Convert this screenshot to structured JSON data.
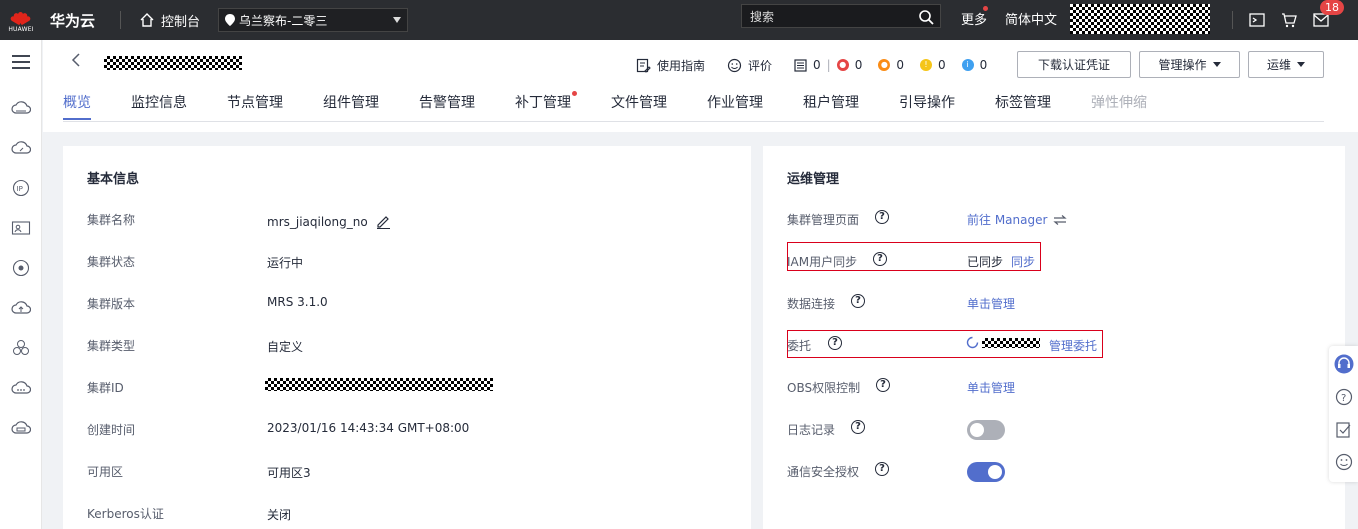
{
  "topbar": {
    "logo_text": "HUAWEI",
    "brand": "华为云",
    "console_label": "控制台",
    "region": "乌兰察布-二零三",
    "search_placeholder": "搜索",
    "more": "更多",
    "language": "简体中文",
    "notification_count": "18"
  },
  "header": {
    "tools": {
      "guide": "使用指南",
      "rate": "评价",
      "alarm_counts": [
        "0",
        "0",
        "0",
        "0",
        "0"
      ]
    },
    "buttons": {
      "download_cred": "下载认证凭证",
      "manage_ops": "管理操作",
      "maintenance": "运维"
    },
    "tabs": [
      {
        "label": "概览",
        "state": "active"
      },
      {
        "label": "监控信息"
      },
      {
        "label": "节点管理"
      },
      {
        "label": "组件管理"
      },
      {
        "label": "告警管理"
      },
      {
        "label": "补丁管理",
        "dot": true
      },
      {
        "label": "文件管理"
      },
      {
        "label": "作业管理"
      },
      {
        "label": "租户管理"
      },
      {
        "label": "引导操作"
      },
      {
        "label": "标签管理"
      },
      {
        "label": "弹性伸缩",
        "state": "disabled"
      }
    ]
  },
  "basic_info": {
    "title": "基本信息",
    "rows": [
      {
        "label": "集群名称",
        "value": "mrs_jiaqilong_no"
      },
      {
        "label": "集群状态",
        "value": "运行中"
      },
      {
        "label": "集群版本",
        "value": "MRS 3.1.0"
      },
      {
        "label": "集群类型",
        "value": "自定义"
      },
      {
        "label": "集群ID",
        "value": ""
      },
      {
        "label": "创建时间",
        "value": "2023/01/16 14:43:34 GMT+08:00"
      },
      {
        "label": "可用区",
        "value": "可用区3"
      },
      {
        "label": "Kerberos认证",
        "value": "关闭"
      }
    ]
  },
  "ops": {
    "title": "运维管理",
    "rows": [
      {
        "label": "集群管理页面",
        "link": "前往 Manager"
      },
      {
        "label": "IAM用户同步",
        "value": "已同步",
        "link": "同步"
      },
      {
        "label": "数据连接",
        "link": "单击管理"
      },
      {
        "label": "委托",
        "link": "管理委托"
      },
      {
        "label": "OBS权限控制",
        "link": "单击管理"
      },
      {
        "label": "日志记录",
        "toggle": false
      },
      {
        "label": "通信安全授权",
        "toggle": true
      }
    ]
  },
  "colors": {
    "accent": "#526ecc",
    "topbar": "#2b2d31",
    "highlight_border": "#d9001b",
    "alert_red": "#e54545"
  }
}
